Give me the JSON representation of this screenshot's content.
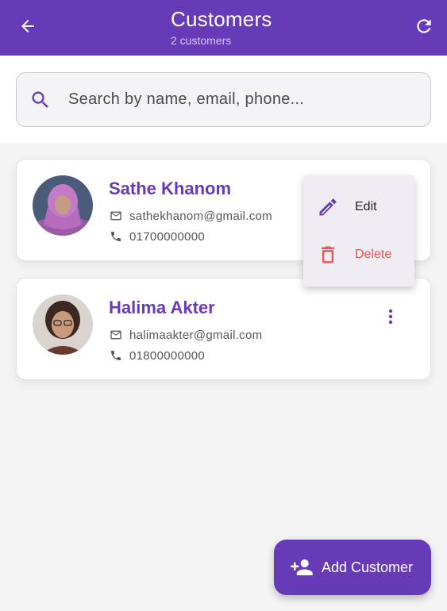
{
  "appbar": {
    "title": "Customers",
    "subtitle": "2 customers",
    "back_icon": "arrow-back-icon",
    "refresh_icon": "refresh-icon",
    "background": "#673ab7"
  },
  "search": {
    "placeholder": "Search by name, email, phone...",
    "value": "",
    "icon": "search-icon"
  },
  "customers": [
    {
      "name": "Sathe Khanom",
      "email": "sathekhanom@gmail.com",
      "phone": "01700000000",
      "avatar": "avatar-photo"
    },
    {
      "name": "Halima Akter",
      "email": "halimaakter@gmail.com",
      "phone": "01800000000",
      "avatar": "avatar-photo"
    }
  ],
  "context_menu": {
    "items": [
      {
        "label": "Edit",
        "icon": "pencil-icon",
        "color": "#673ab7"
      },
      {
        "label": "Delete",
        "icon": "trash-icon",
        "color": "#ef5350"
      }
    ]
  },
  "fab": {
    "label": "Add Customer",
    "icon": "person-add-icon"
  },
  "colors": {
    "accent": "#673ab7",
    "danger": "#ef5350",
    "background": "#f4f4f4"
  }
}
